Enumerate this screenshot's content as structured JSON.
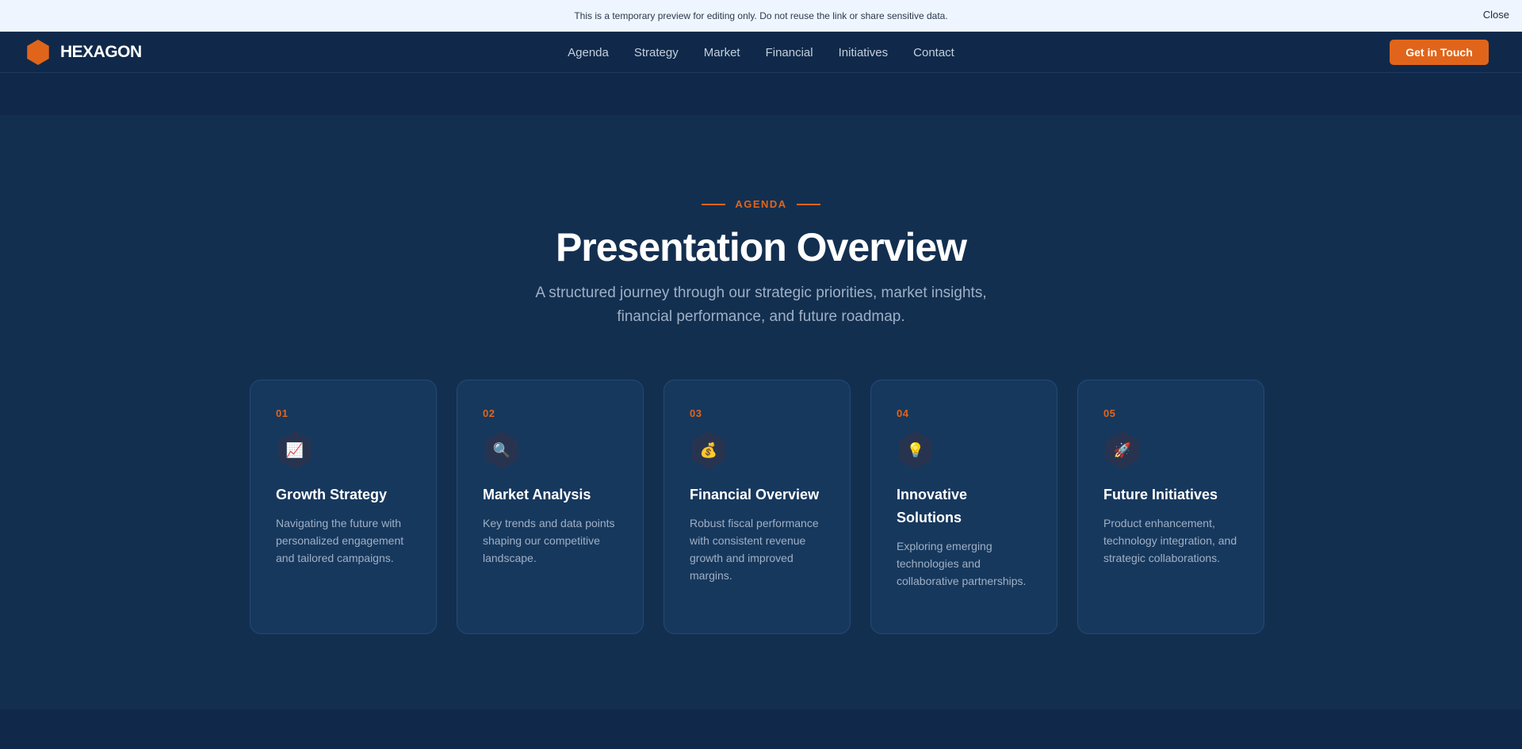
{
  "banner": {
    "text": "This is a temporary preview for editing only. Do not reuse the link or share sensitive data.",
    "close_label": "Close"
  },
  "nav": {
    "brand": "HEXAGON",
    "links": [
      "Agenda",
      "Strategy",
      "Market",
      "Financial",
      "Initiatives",
      "Contact"
    ],
    "cta": "Get in Touch"
  },
  "agenda": {
    "eyebrow": "AGENDA",
    "title": "Presentation Overview",
    "subtitle": "A structured journey through our strategic priorities, market insights, financial performance, and future roadmap.",
    "cards": [
      {
        "number": "01",
        "icon": "📈",
        "title": "Growth Strategy",
        "description": "Navigating the future with personalized engagement and tailored campaigns."
      },
      {
        "number": "02",
        "icon": "🔍",
        "title": "Market Analysis",
        "description": "Key trends and data points shaping our competitive landscape."
      },
      {
        "number": "03",
        "icon": "💰",
        "title": "Financial Overview",
        "description": "Robust fiscal performance with consistent revenue growth and improved margins."
      },
      {
        "number": "04",
        "icon": "💡",
        "title": "Innovative Solutions",
        "description": "Exploring emerging technologies and collaborative partnerships."
      },
      {
        "number": "05",
        "icon": "🚀",
        "title": "Future Initiatives",
        "description": "Product enhancement, technology integration, and strategic collaborations."
      }
    ]
  },
  "colors": {
    "accent": "#e0651b",
    "background": "#132f50",
    "card": "#17385d"
  }
}
